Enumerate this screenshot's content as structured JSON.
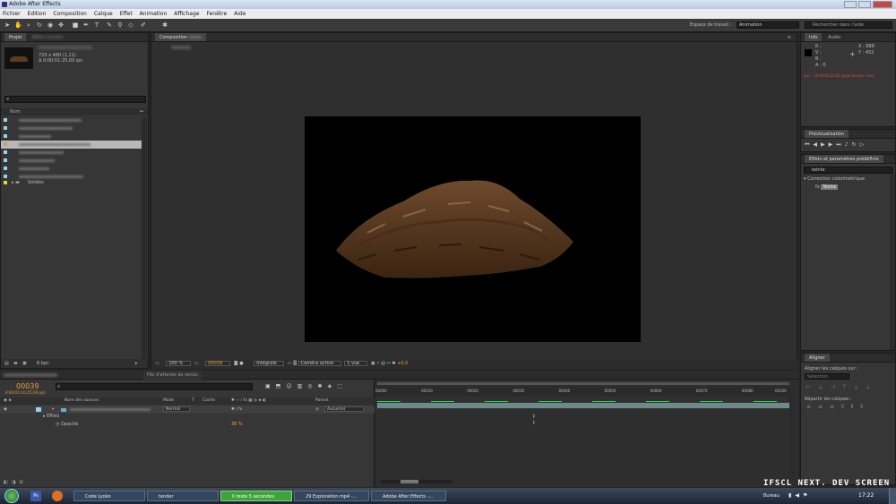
{
  "window": {
    "title": "Adobe After Effects"
  },
  "menu": [
    "Fichier",
    "Edition",
    "Composition",
    "Calque",
    "Effet",
    "Animation",
    "Affichage",
    "Fenêtre",
    "Aide"
  ],
  "toolbar": {
    "workspace_label": "Espace de travail :",
    "workspace_value": "Animation",
    "search_placeholder": "Rechercher dans l'aide"
  },
  "project": {
    "tabs": [
      "Projet",
      "Effets (ocean)"
    ],
    "meta_line1": "720 x 480 (1,11)",
    "meta_line2": "Δ 0:00:01:25,00 ips",
    "col_name": "Nom",
    "folder": "Solides",
    "bpc": "8 bpc"
  },
  "comp": {
    "tab": "Composition",
    "zoom": "100 %",
    "timecode": "00039",
    "resolution": "Intégrale",
    "camera": "Caméra active",
    "views": "1 vue",
    "exposure": "+0,0",
    "render_queue_tab": "File d'attente de rendu"
  },
  "info": {
    "tabs": [
      "Info",
      "Audio"
    ],
    "r": "R :",
    "g": "V :",
    "b": "B :",
    "a": "A : 0",
    "x": "X : 889",
    "y": "Y : 452",
    "status": "ips : 19,878/25,00 (pas temps réel)"
  },
  "preview": {
    "tab": "Prévisualisation"
  },
  "effects": {
    "tab": "Effets et paramètres prédéfinis",
    "search_value": "teinte",
    "category": "Correction colorimétrique",
    "item": "Teinte"
  },
  "align": {
    "tab": "Aligner",
    "align_label": "Aligner les calques sur :",
    "align_value": "Sélection",
    "distribute_label": "Répartir les calques :"
  },
  "timeline": {
    "timecode": "00039",
    "timecode_sub": "0:00:01:14 (25,00 ips)",
    "headers": [
      "Nom des sources",
      "Mode",
      "T",
      "Cache",
      "Parent"
    ],
    "layer_mode": "Normal",
    "layer_parent": "Aucun(e)",
    "effects_label": "Effets",
    "opacity_label": "Opacité",
    "opacity_value": "36 %",
    "ticks": [
      "00000",
      "00010",
      "00020",
      "00030",
      "00040",
      "00050",
      "00060",
      "00070",
      "00080",
      "00100"
    ],
    "time_fraction": 0.39
  },
  "watermark": "IFSCL NEXT. DEV SCREEN",
  "taskbar": {
    "items": [
      "Code Lyoko",
      "tender",
      "Il reste 5 secondes",
      "29 Exploration.mp4 -...",
      "Adobe After Effects -..."
    ],
    "desktop": "Bureau",
    "clock": "17:22"
  }
}
